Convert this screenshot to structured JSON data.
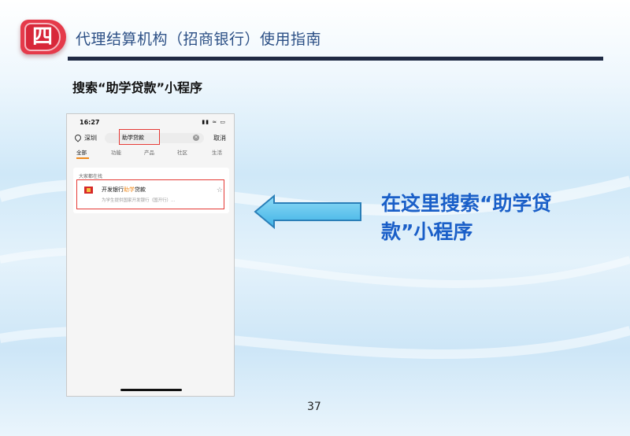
{
  "header": {
    "badge": "四",
    "title": "代理结算机构（招商银行）使用指南"
  },
  "section_title": "搜索“助学贷款”小程序",
  "phone": {
    "status_time": "16:27",
    "status_icons": "▮▮ ≈ ▭",
    "location": "深圳",
    "search_value": "助学贷款",
    "cancel_label": "取消",
    "tabs": [
      "全部",
      "功能",
      "产品",
      "社区",
      "生活"
    ],
    "result": {
      "caption": "大家都在找",
      "name_prefix": "开发银行",
      "name_highlight": "助学",
      "name_suffix": "贷款",
      "description": "为学生提供国家开发银行（国开行）..."
    }
  },
  "callout": "在这里搜索“助学贷款”小程序",
  "page_number": "37",
  "colors": {
    "badge": "#e53a4a",
    "header_text": "#2b4f85",
    "callout": "#1a5fc8",
    "highlight_box": "#e53935",
    "arrow_fill": "#5bc4ee"
  }
}
